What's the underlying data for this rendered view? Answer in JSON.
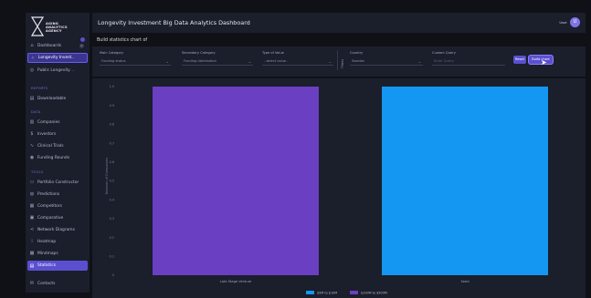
{
  "brand": {
    "logo_text": "AGING\nANALYTICS\nAGENCY"
  },
  "header": {
    "title": "Longevity Investment Big Data Analytics Dashboard",
    "user_label": "User",
    "avatar_initial": "U"
  },
  "sidebar": {
    "items": [
      {
        "label": "Dashboards",
        "icon": "home-icon",
        "badge": "0"
      },
      {
        "label": "Longevity Invest..",
        "icon": "sparkle-icon"
      },
      {
        "label": "Public Longevity ..",
        "icon": "globe-icon"
      }
    ],
    "reports_label": "REPORTS",
    "reports_items": [
      {
        "label": "Downloadable",
        "icon": "document-icon"
      }
    ],
    "data_label": "DATA",
    "data_items": [
      {
        "label": "Companies",
        "icon": "building-icon"
      },
      {
        "label": "Investors",
        "icon": "dollar-icon"
      },
      {
        "label": "Clinical Trials",
        "icon": "pulse-icon"
      },
      {
        "label": "Funding Rounds",
        "icon": "coins-icon"
      }
    ],
    "tools_label": "TOOLS",
    "tools_items": [
      {
        "label": "Portfolio Constructor",
        "icon": "briefcase-icon"
      },
      {
        "label": "Predictions",
        "icon": "target-icon"
      },
      {
        "label": "Competitors",
        "icon": "table-icon"
      },
      {
        "label": "Comparative",
        "icon": "compare-icon"
      },
      {
        "label": "Network Diagrams",
        "icon": "share-icon"
      },
      {
        "label": "Heatmap",
        "icon": "heat-icon"
      },
      {
        "label": "Mindmaps",
        "icon": "grid-icon"
      },
      {
        "label": "Statistics",
        "icon": "chart-icon"
      }
    ],
    "bottom_items": [
      {
        "label": "Contacts",
        "icon": "mail-icon"
      }
    ]
  },
  "subtitle": "Build statistics chart of",
  "filters": {
    "main_category_label": "Main Category",
    "main_category_value": "Funding status",
    "secondary_category_label": "Secondary Category",
    "secondary_category_value": "Funding distribution",
    "type_of_value_label": "Type of Value",
    "type_of_value_value": "- select value -",
    "vertical_label": "Filters",
    "country_label": "Country",
    "country_value": "Sweden",
    "custom_query_label": "Custom Query",
    "custom_query_placeholder": "Enter Query",
    "reset_label": "Reset",
    "build_label": "Build chart"
  },
  "accent_colors": {
    "primary": "#5b4fd0",
    "bar_purple": "#6a3fc2",
    "bar_blue": "#1397f2"
  },
  "chart_data": {
    "type": "bar",
    "categories": [
      "Late Stage Venture",
      "Seed"
    ],
    "series": [
      {
        "name": "$5M to $10M",
        "values": [
          0,
          1
        ],
        "color": "#1397f2"
      },
      {
        "name": "$100M to $500M",
        "values": [
          1,
          0
        ],
        "color": "#6a3fc2"
      }
    ],
    "ylabel": "Number of Companies",
    "ylim": [
      0,
      1
    ],
    "yticks": [
      "0",
      "0.1",
      "0.2",
      "0.3",
      "0.4",
      "0.5",
      "0.6",
      "0.7",
      "0.8",
      "0.9",
      "1.0"
    ],
    "legend": "bottom"
  }
}
